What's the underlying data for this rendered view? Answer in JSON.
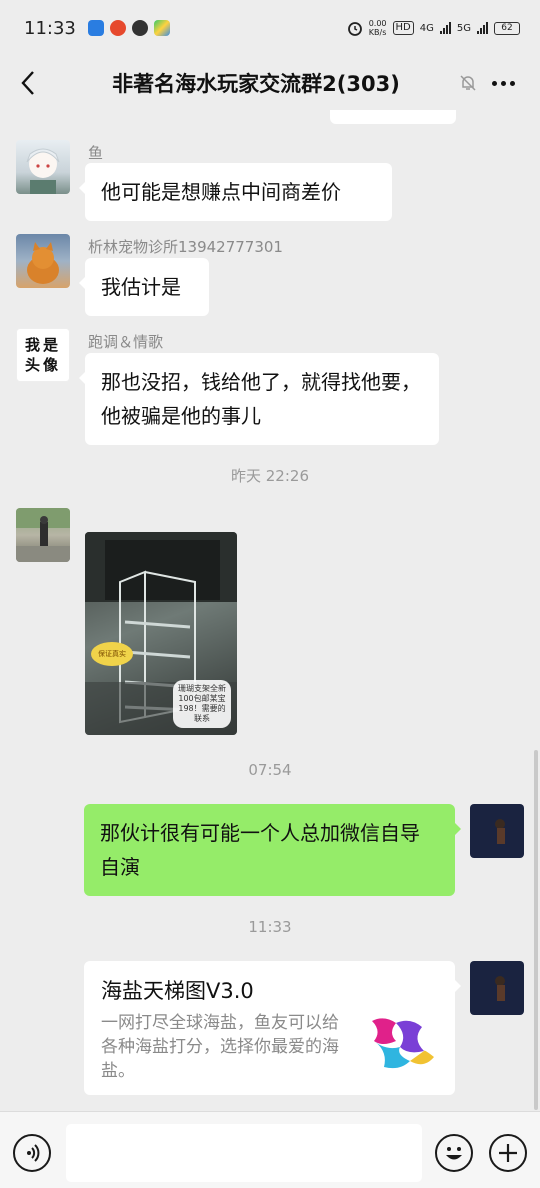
{
  "status_bar": {
    "time": "11:33",
    "net_speed": "0.00\nKB/s",
    "hd_label": "HD",
    "net4g": "4G",
    "net5g": "5G",
    "battery": "62"
  },
  "header": {
    "title": "非著名海水玩家交流群2(303)"
  },
  "messages": [
    {
      "sender": "鱼",
      "text": "他可能是想赚点中间商差价"
    },
    {
      "sender": "析林宠物诊所13942777301",
      "text": "我估计是"
    },
    {
      "sender": "跑调＆情歌",
      "avatar_text": "我是\n头像",
      "text": "那也没招，钱给他了，就得找他要，他被骗是他的事儿"
    }
  ],
  "time_separators": [
    "昨天 22:26",
    "07:54",
    "11:33"
  ],
  "image_message": {
    "caption": "珊瑚支架全新100包邮某宝198！需要的联系",
    "sticker": "保证真实"
  },
  "my_messages": [
    {
      "text": "那伙计很有可能一个人总加微信自导自演"
    }
  ],
  "card": {
    "title": "海盐天梯图V3.0",
    "description": "一网打尽全球海盐，鱼友可以给各种海盐打分，选择你最爱的海盐。"
  },
  "colors": {
    "background": "#ededed",
    "my_bubble": "#95ec69",
    "other_bubble": "#ffffff"
  }
}
